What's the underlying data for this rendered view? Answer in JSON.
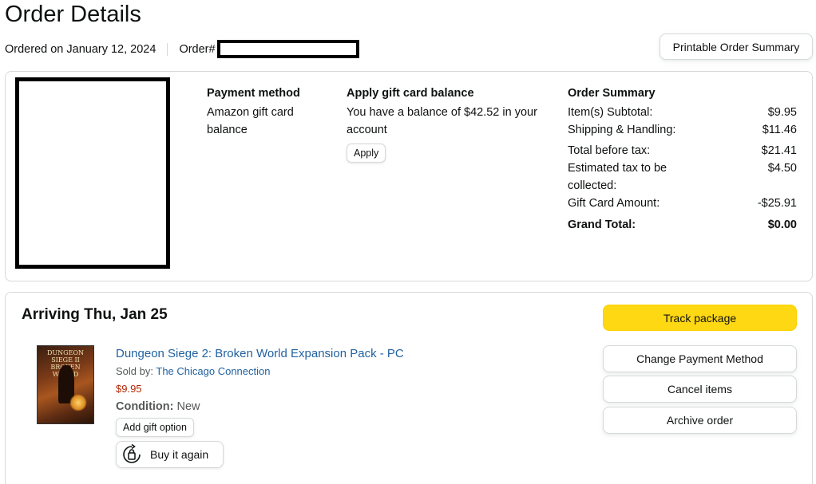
{
  "page": {
    "title": "Order Details"
  },
  "meta": {
    "ordered_on": "Ordered on January 12, 2024",
    "order_label": "Order#"
  },
  "actions": {
    "printable_summary": "Printable Order Summary"
  },
  "payment": {
    "heading": "Payment method",
    "method": "Amazon gift card balance"
  },
  "gift_card": {
    "heading": "Apply gift card balance",
    "balance_text": "You have a balance of $42.52 in your account",
    "apply_label": "Apply"
  },
  "summary": {
    "heading": "Order Summary",
    "rows": [
      {
        "label": "Item(s) Subtotal:",
        "value": "$9.95"
      },
      {
        "label": "Shipping & Handling:",
        "value": "$11.46"
      },
      {
        "label": "Total before tax:",
        "value": "$21.41"
      },
      {
        "label": "Estimated tax to be collected:",
        "value": "$4.50"
      },
      {
        "label": "Gift Card Amount:",
        "value": "-$25.91"
      }
    ],
    "grand_total_label": "Grand Total:",
    "grand_total_value": "$0.00"
  },
  "shipment": {
    "arriving": "Arriving Thu, Jan 25",
    "product": {
      "title": "Dungeon Siege 2: Broken World Expansion Pack - PC",
      "sold_by_label": "Sold by:",
      "seller": "The Chicago Connection",
      "price": "$9.95",
      "condition_label": "Condition:",
      "condition_value": "New",
      "thumb_text": "DUNGEON SIEGE II BROKEN WORLD",
      "thumb_icon": "product-cover-image"
    },
    "add_gift_option": "Add gift option",
    "buy_again": "Buy it again",
    "buy_again_icon": "buy-again-icon",
    "track_package": "Track package",
    "change_payment": "Change Payment Method",
    "cancel_items": "Cancel items",
    "archive_order": "Archive order"
  },
  "colors": {
    "link": "#2162a1",
    "price": "#b12704",
    "track_button": "#ffd814",
    "border": "#d5d9d9",
    "text": "#0f1111"
  }
}
